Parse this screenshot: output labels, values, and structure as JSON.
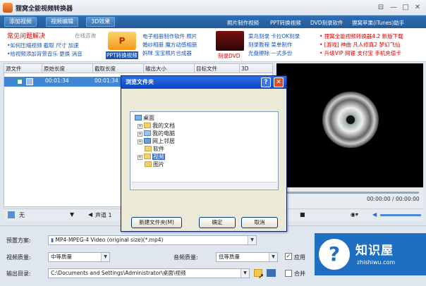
{
  "window": {
    "title": "狸窝全能视频转换器",
    "controls": [
      "⊟",
      "—",
      "□",
      "✕"
    ]
  },
  "toolbar": {
    "add_video": "添加视频",
    "edit_video": "视频编辑",
    "effects_3d": "3D效果",
    "links": [
      "照片制作视频",
      "PPT转换视频",
      "DVD刻录软件",
      "狸窝苹果(iTunes)助手"
    ]
  },
  "promo": {
    "faq_title": "常见问题解决",
    "online": "在线咨询",
    "faq_items": [
      "•如何压缩视频 截取 尺寸 加速",
      "•给视频添加背景音乐 更换 消音"
    ],
    "ppt_label": "PPT转换视频",
    "mid_lines": [
      "电子相册制作软件 照片",
      "婚纱相册 魔方动感相册",
      "妈咪 宝宝照片合成器"
    ],
    "dvd_label": "刻录DVD",
    "dvd_lines": [
      "菜鸟刻录 卡拉OK刻录",
      "刻录教程 菜单制作",
      "光盘擦除 一式多份"
    ],
    "right_lines": [
      "• 狸窝全能视频转换器4.2 新版下载",
      "• [游戏] 神曲 凡人修真2 梦幻飞仙",
      "• 升级VIP 网银 支付宝 手机充值卡"
    ]
  },
  "file_list": {
    "headers": [
      "源文件",
      "原始长度",
      "截取长度",
      "输出大小",
      "目标文件",
      "3D"
    ],
    "rows": [
      {
        "source": "",
        "orig": "00:01:34",
        "cut": "00:01:34"
      }
    ]
  },
  "player": {
    "timecode": "00:00:00 / 00:00:00"
  },
  "controls_bar": {
    "subtitle": "无",
    "audio": "声道 1"
  },
  "settings": {
    "preset_label": "预置方案:",
    "preset_value": "MP4-MPEG-4 Video (original size)(*.mp4)",
    "video_quality_label": "视频质量:",
    "video_quality_value": "中等质量",
    "audio_quality_label": "音频质量:",
    "audio_quality_value": "低等质量",
    "output_label": "输出目录:",
    "output_value": "C:\\Documents and Settings\\Administrator\\桌面\\视频",
    "apply_all": "应用",
    "merge": "合并"
  },
  "dialog": {
    "title": "浏览文件夹",
    "help": "?",
    "close": "✕",
    "tree": [
      {
        "label": "桌面"
      },
      {
        "label": "我的文档"
      },
      {
        "label": "我的电脑"
      },
      {
        "label": "网上邻居"
      },
      {
        "label": "软件"
      },
      {
        "label": "视频"
      },
      {
        "label": "图片"
      }
    ],
    "new_folder": "新建文件夹(M)",
    "ok": "确定",
    "cancel": "取消"
  },
  "watermark": {
    "logo": "?",
    "name": "知识屋",
    "url": "zhishiwu.com"
  }
}
